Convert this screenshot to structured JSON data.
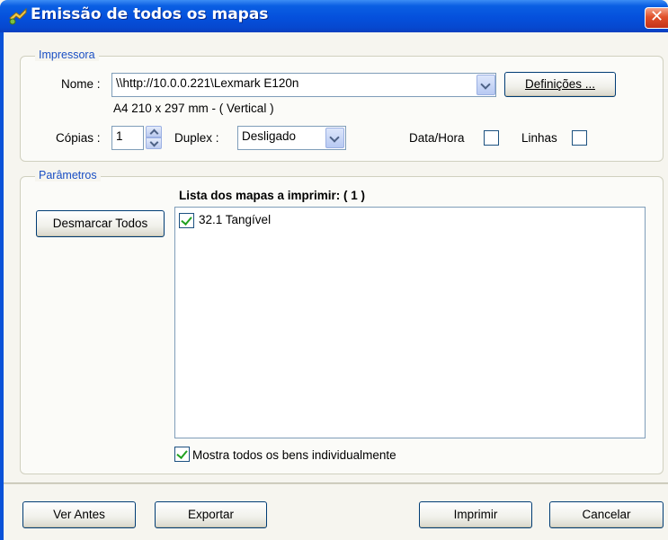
{
  "window": {
    "title": "Emissão de todos os mapas",
    "close_glyph": "✕",
    "accent_color": "#0550dc"
  },
  "printer_group": {
    "legend": "Impressora",
    "name_label": "Nome :",
    "name_value": "\\\\http://10.0.0.221\\Lexmark E120n",
    "settings_button": "Definições ...",
    "paper_info": "A4 210 x 297 mm  -  ( Vertical )",
    "copies_label": "Cópias :",
    "copies_value": "1",
    "duplex_label": "Duplex :",
    "duplex_value": "Desligado",
    "datetime_label": "Data/Hora",
    "datetime_checked": false,
    "lines_label": "Linhas",
    "lines_checked": false
  },
  "params_group": {
    "legend": "Parâmetros",
    "deselect_button": "Desmarcar Todos",
    "list_title": "Lista dos mapas a imprimir: ( 1 )",
    "list_items": [
      {
        "label": "32.1 Tangível",
        "checked": true
      }
    ],
    "show_all_label": "Mostra todos os bens individualmente",
    "show_all_checked": true
  },
  "footer": {
    "preview_button": "Ver Antes",
    "export_button": "Exportar",
    "print_button": "Imprimir",
    "cancel_button": "Cancelar"
  }
}
